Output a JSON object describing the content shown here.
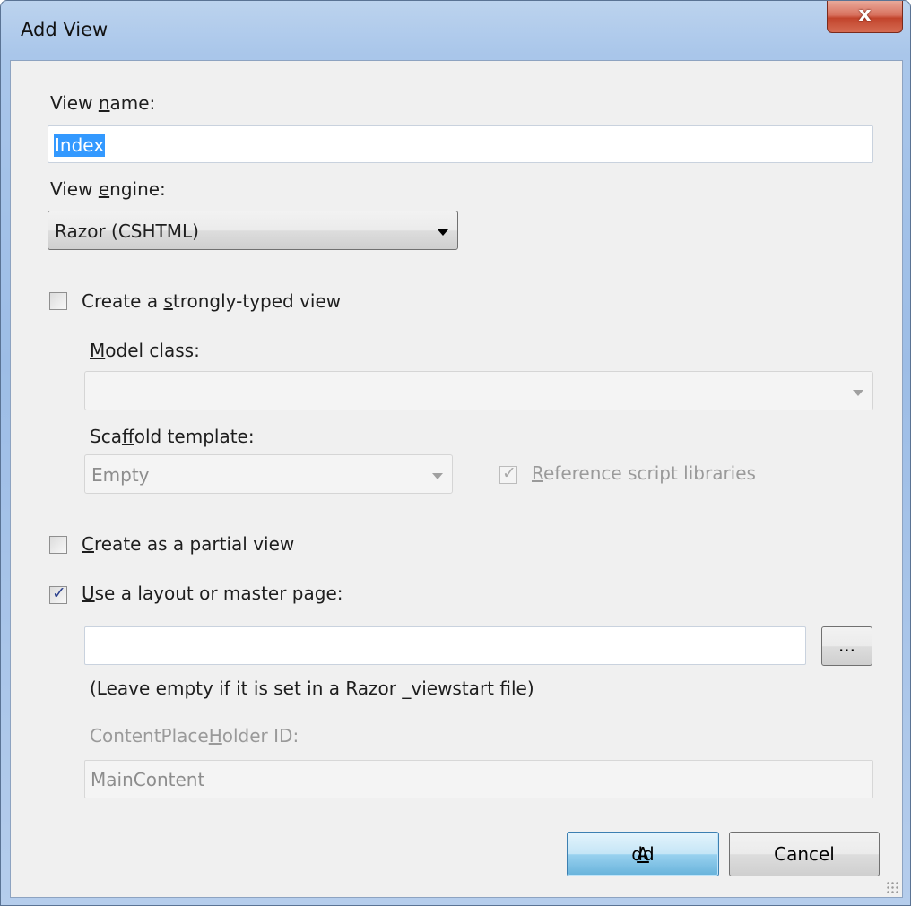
{
  "window": {
    "title": "Add View",
    "close_glyph": "x"
  },
  "view_name": {
    "label_pre": "View ",
    "label_key": "n",
    "label_post": "ame:",
    "value": "Index"
  },
  "view_engine": {
    "label_pre": "View ",
    "label_key": "e",
    "label_post": "ngine:",
    "selected": "Razor (CSHTML)"
  },
  "strongly_typed": {
    "label_pre": "Create a ",
    "label_key": "s",
    "label_post": "trongly-typed view",
    "checked": false
  },
  "model_class": {
    "label_key": "M",
    "label_post": "odel class:",
    "value": ""
  },
  "scaffold_template": {
    "label_pre": "Sca",
    "label_key": "f",
    "label_post": "fold template:",
    "selected": "Empty"
  },
  "reference_scripts": {
    "label_key": "R",
    "label_post": "eference script libraries",
    "checked": true,
    "check_glyph": "✓"
  },
  "partial_view": {
    "label_key": "C",
    "label_post": "reate as a partial view",
    "checked": false
  },
  "layout_page": {
    "label_key": "U",
    "label_post": "se a layout or master page:",
    "checked": true,
    "check_glyph": "✓",
    "value": "",
    "browse_label": "...",
    "hint": "(Leave empty if it is set in a Razor _viewstart file)"
  },
  "content_placeholder": {
    "label_pre": "ContentPlace",
    "label_key": "H",
    "label_post": "older ID:",
    "value": "MainContent"
  },
  "buttons": {
    "add_key": "A",
    "add_post": "dd",
    "cancel": "Cancel"
  },
  "colors": {
    "title_bar": "#a9c6ea",
    "close_button": "#c2442c",
    "selection": "#3399ff",
    "default_button": "#98d1ef"
  }
}
